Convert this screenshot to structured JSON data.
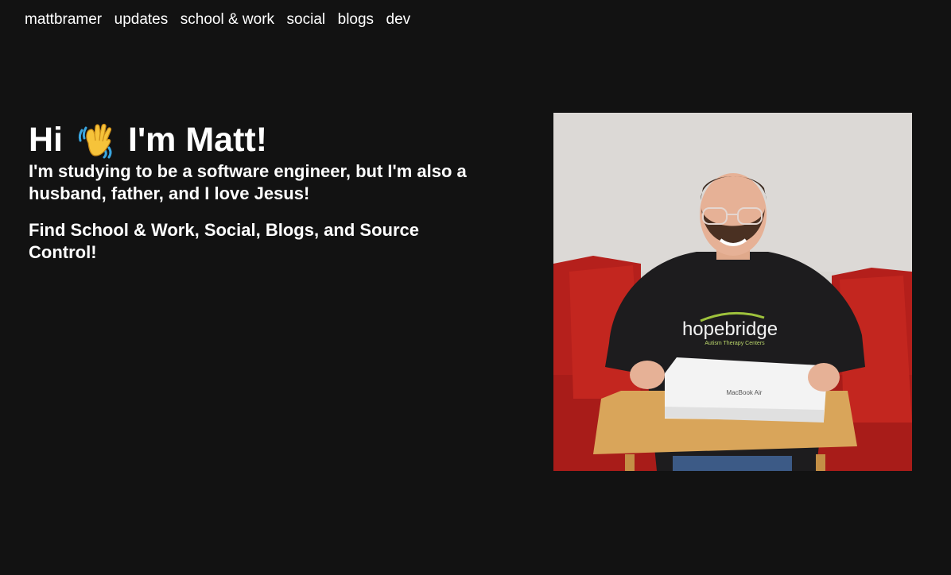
{
  "nav": {
    "items": [
      {
        "label": "mattbramer"
      },
      {
        "label": "updates"
      },
      {
        "label": "school & work"
      },
      {
        "label": "social"
      },
      {
        "label": "blogs"
      },
      {
        "label": "dev"
      }
    ]
  },
  "hero": {
    "greeting_prefix": "Hi",
    "greeting_suffix": "I'm Matt!",
    "wave_icon": "waving-hand-icon",
    "intro": "I'm studying to be a software engineer, but I'm also a husband, father, and I love Jesus!",
    "find": "Find School & Work, Social, Blogs, and Source Control!"
  },
  "photo": {
    "shirt_text": "hopebridge",
    "shirt_subtext": "Autism Therapy Centers",
    "box_text": "MacBook Air"
  },
  "colors": {
    "background": "#121212",
    "text": "#ffffff",
    "wave_yellow": "#f6c33a",
    "wave_blue": "#3aa6e0"
  }
}
